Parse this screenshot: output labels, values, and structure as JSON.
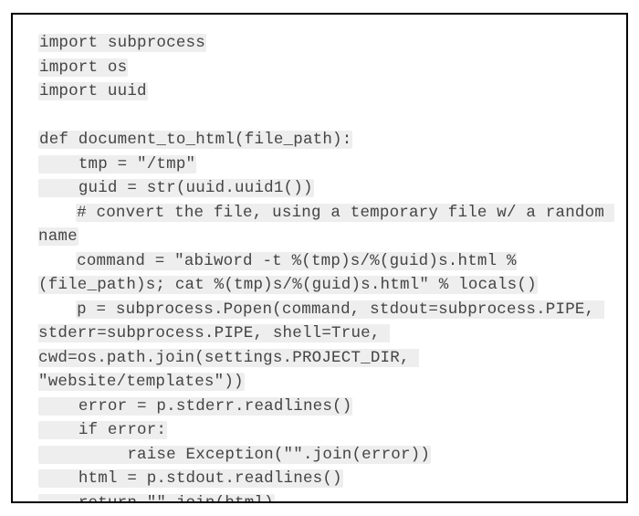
{
  "lines": [
    {
      "indent": 0,
      "wrap": false,
      "text": "import subprocess",
      "hl": true
    },
    {
      "indent": 0,
      "wrap": false,
      "text": "import os",
      "hl": true
    },
    {
      "indent": 0,
      "wrap": false,
      "text": "import uuid",
      "hl": true
    },
    {
      "indent": 0,
      "wrap": false,
      "text": "",
      "hl": false
    },
    {
      "indent": 0,
      "wrap": false,
      "text": "def document_to_html(file_path):",
      "hl": true
    },
    {
      "indent": 1,
      "wrap": false,
      "text": "tmp = \"/tmp\"",
      "hl": true
    },
    {
      "indent": 1,
      "wrap": false,
      "text": "guid = str(uuid.uuid1())",
      "hl": true
    },
    {
      "indent": 1,
      "wrap": true,
      "text": "# convert the file, using a temporary file w/ a random name",
      "hl": true
    },
    {
      "indent": 1,
      "wrap": true,
      "text": "command = \"abiword -t %(tmp)s/%(guid)s.html %(file_path)s; cat %(tmp)s/%(guid)s.html\" % locals()",
      "hl": true
    },
    {
      "indent": 1,
      "wrap": true,
      "text": "p = subprocess.Popen(command, stdout=subprocess.PIPE, stderr=subprocess.PIPE, shell=True, cwd=os.path.join(settings.PROJECT_DIR, \"website/templates\"))",
      "hl": true
    },
    {
      "indent": 1,
      "wrap": false,
      "text": "error = p.stderr.readlines()",
      "hl": true
    },
    {
      "indent": 1,
      "wrap": false,
      "text": "if error:",
      "hl": true
    },
    {
      "indent": 2,
      "wrap": false,
      "text": " raise Exception(\"\".join(error))",
      "hl": true
    },
    {
      "indent": 1,
      "wrap": false,
      "text": "html = p.stdout.readlines()",
      "hl": true
    },
    {
      "indent": 1,
      "wrap": false,
      "text": "return \"\".join(html)",
      "hl": true
    }
  ],
  "indent_unit": "    "
}
